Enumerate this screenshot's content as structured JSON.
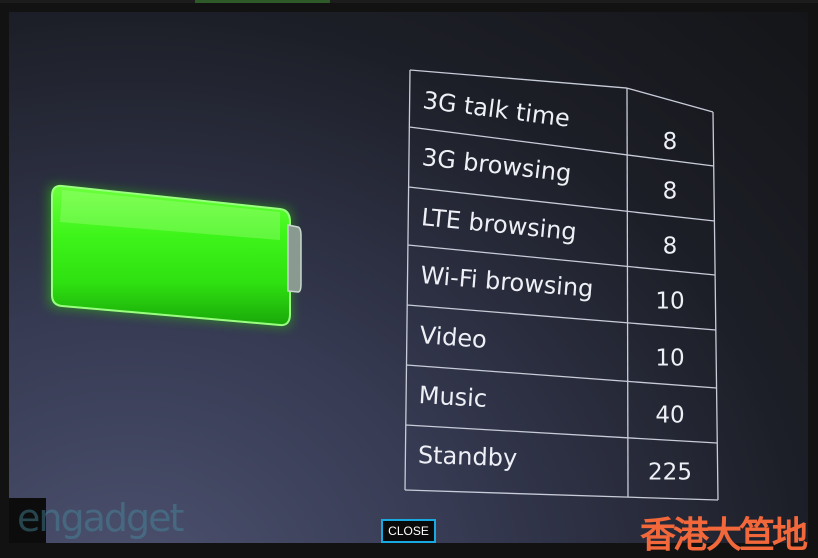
{
  "table": {
    "rows": [
      {
        "label": "3G talk time",
        "value": "8"
      },
      {
        "label": "3G browsing",
        "value": "8"
      },
      {
        "label": "LTE browsing",
        "value": "8"
      },
      {
        "label": "Wi-Fi browsing",
        "value": "10"
      },
      {
        "label": "Video",
        "value": "10"
      },
      {
        "label": "Music",
        "value": "40"
      },
      {
        "label": "Standby",
        "value": "225"
      }
    ]
  },
  "battery": {
    "level": 1.0,
    "color": "#3cff1e"
  },
  "watermarks": {
    "engadget": "engadget",
    "chinese": "香港大笪地"
  },
  "close_label": "CLOSE",
  "colors": {
    "close_border": "#17a9e0",
    "chinese_watermark": "#f2683a"
  }
}
